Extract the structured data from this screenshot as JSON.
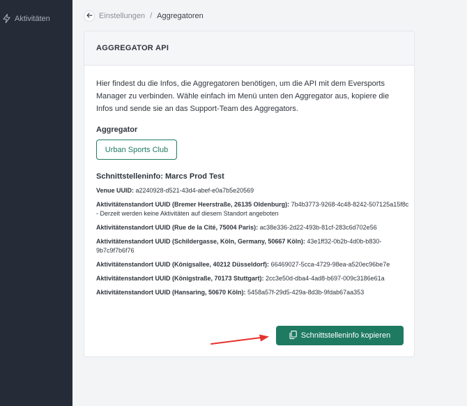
{
  "sidebar": {
    "items": [
      {
        "label": "Aktivitäten",
        "icon": "lightning-icon"
      }
    ]
  },
  "breadcrumb": {
    "back_icon": "arrow-left-icon",
    "parent": "Einstellungen",
    "separator": "/",
    "current": "Aggregatoren"
  },
  "card": {
    "title": "AGGREGATOR API",
    "intro": "Hier findest du die Infos, die Aggregatoren benötigen, um die API mit dem Eversports Manager zu verbinden. Wähle einfach im Menü unten den Aggregator aus, kopiere die Infos und sende sie an das Support-Team des Aggregators.",
    "aggregator_label": "Aggregator",
    "aggregator_selected": "Urban Sports Club",
    "info_title": "Schnittstelleninfo: Marcs Prod Test",
    "info_rows": [
      {
        "label": "Venue UUID:",
        "value": " a2240928-d521-43d4-abef-e0a7b5e20569"
      },
      {
        "label": "Aktivitätenstandort UUID (Bremer Heerstraße, 26135 Oldenburg):",
        "value": " 7b4b3773-9268-4c48-8242-507125a15f8c - Derzeit werden keine Aktivitäten auf diesem Standort angeboten"
      },
      {
        "label": "Aktivitätenstandort UUID (Rue de la Cité, 75004 Paris):",
        "value": " ac38e336-2d22-493b-81cf-283c6d702e56"
      },
      {
        "label": "Aktivitätenstandort UUID (Schildergasse, Köln, Germany, 50667 Köln):",
        "value": " 43e1ff32-0b2b-4d0b-b830-9b7c9f7b6f76"
      },
      {
        "label": "Aktivitätenstandort UUID (Königsallee, 40212 Düsseldorf):",
        "value": " 66469027-5cca-4729-98ea-a520ec96be7e"
      },
      {
        "label": "Aktivitätenstandort UUID (Königstraße, 70173 Stuttgart):",
        "value": " 2cc3e50d-dba4-4ad8-b697-009c3186e61a"
      },
      {
        "label": "Aktivitätenstandort UUID (Hansaring, 50670 Köln):",
        "value": " 5458a57f-29d5-429a-8d3b-9fdab67aa353"
      }
    ],
    "copy_button": "Schnittstelleninfo kopieren",
    "copy_icon": "copy-icon"
  },
  "colors": {
    "sidebar_bg": "#262b38",
    "accent": "#1f7a62",
    "arrow": "#e5322d"
  }
}
